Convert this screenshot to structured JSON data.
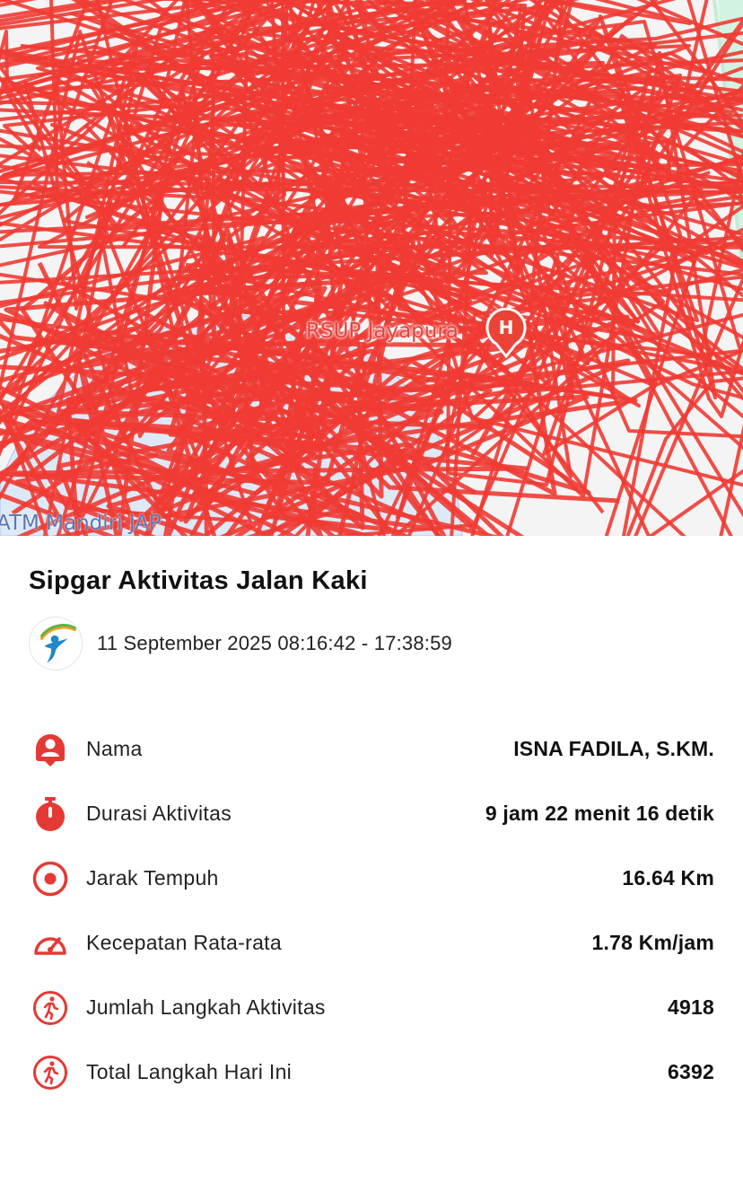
{
  "map": {
    "poi_label": "RSUP Jayapura",
    "atm_label": "ATM Mandiri JAP",
    "hospital_marker_letter": "H",
    "track_color": "#ef3b33",
    "water_color": "#dde9f7",
    "park_color": "#d3f3e2"
  },
  "activity": {
    "title": "Sipgar Aktivitas Jalan Kaki",
    "date_range": "11 September 2025 08:16:42 - 17:38:59",
    "accent_color": "#e53935",
    "stats": [
      {
        "icon": "person-pin-icon",
        "label": "Nama",
        "value": "ISNA FADILA, S.KM."
      },
      {
        "icon": "stopwatch-icon",
        "label": "Durasi Aktivitas",
        "value": "9 jam 22 menit 16 detik"
      },
      {
        "icon": "target-icon",
        "label": "Jarak Tempuh",
        "value": "16.64 Km"
      },
      {
        "icon": "speedometer-icon",
        "label": "Kecepatan Rata-rata",
        "value": "1.78 Km/jam"
      },
      {
        "icon": "walking-icon",
        "label": "Jumlah Langkah Aktivitas",
        "value": "4918"
      },
      {
        "icon": "walking-icon",
        "label": "Total Langkah Hari Ini",
        "value": "6392"
      }
    ]
  }
}
